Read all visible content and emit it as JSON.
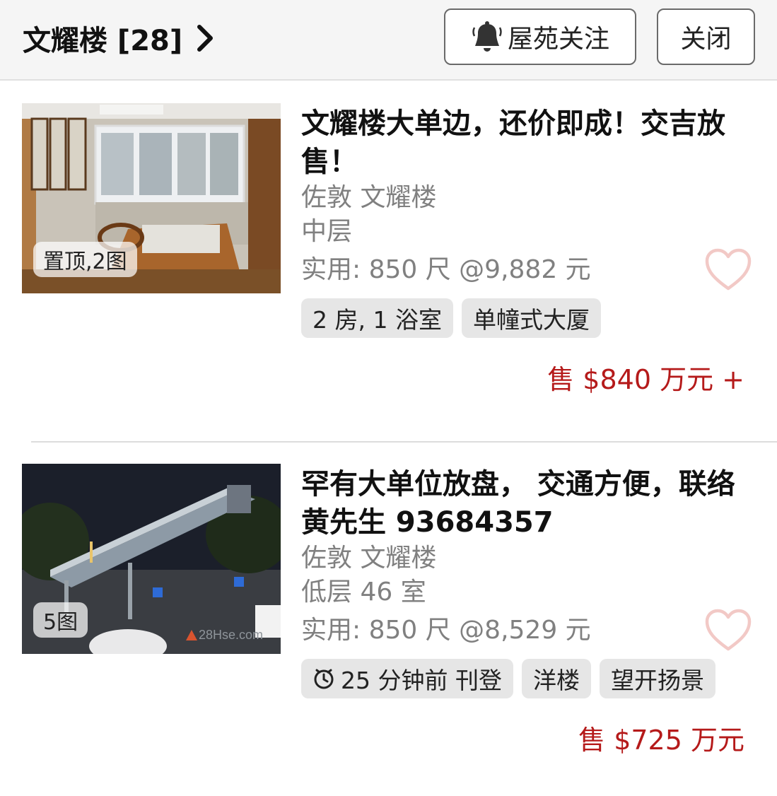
{
  "header": {
    "title": "文耀楼 [28]",
    "follow_label": "屋苑关注",
    "close_label": "关闭"
  },
  "listings": [
    {
      "title": "文耀楼大单边，还价即成！交吉放售！",
      "district": "佐敦 文耀楼",
      "floor": "中层",
      "area": "实用: 850 尺  @9,882 元",
      "photo_badge": "置顶,2图",
      "tags": [
        "2 房, 1 浴室",
        "单幢式大厦"
      ],
      "price": "售 $840 万元 +"
    },
    {
      "title": "罕有大单位放盘， 交通方便，联络黄先生 93684357",
      "district": "佐敦 文耀楼",
      "floor": "低层 46 室",
      "area": "实用: 850 尺  @8,529 元",
      "photo_badge": "5图",
      "posted": "25 分钟前 刊登",
      "tags": [
        "25 分钟前 刊登",
        "洋楼",
        "望开扬景"
      ],
      "price": "售 $725 万元",
      "watermark": "28Hse.com"
    }
  ],
  "colors": {
    "price": "#b51a1a",
    "heart": "#f2c9c6",
    "header_bg": "#f5f5f5",
    "tag_bg": "#e6e6e6",
    "meta_text": "#808080"
  },
  "icons": [
    "chevron-right-icon",
    "bell-icon",
    "heart-icon",
    "clock-icon"
  ]
}
